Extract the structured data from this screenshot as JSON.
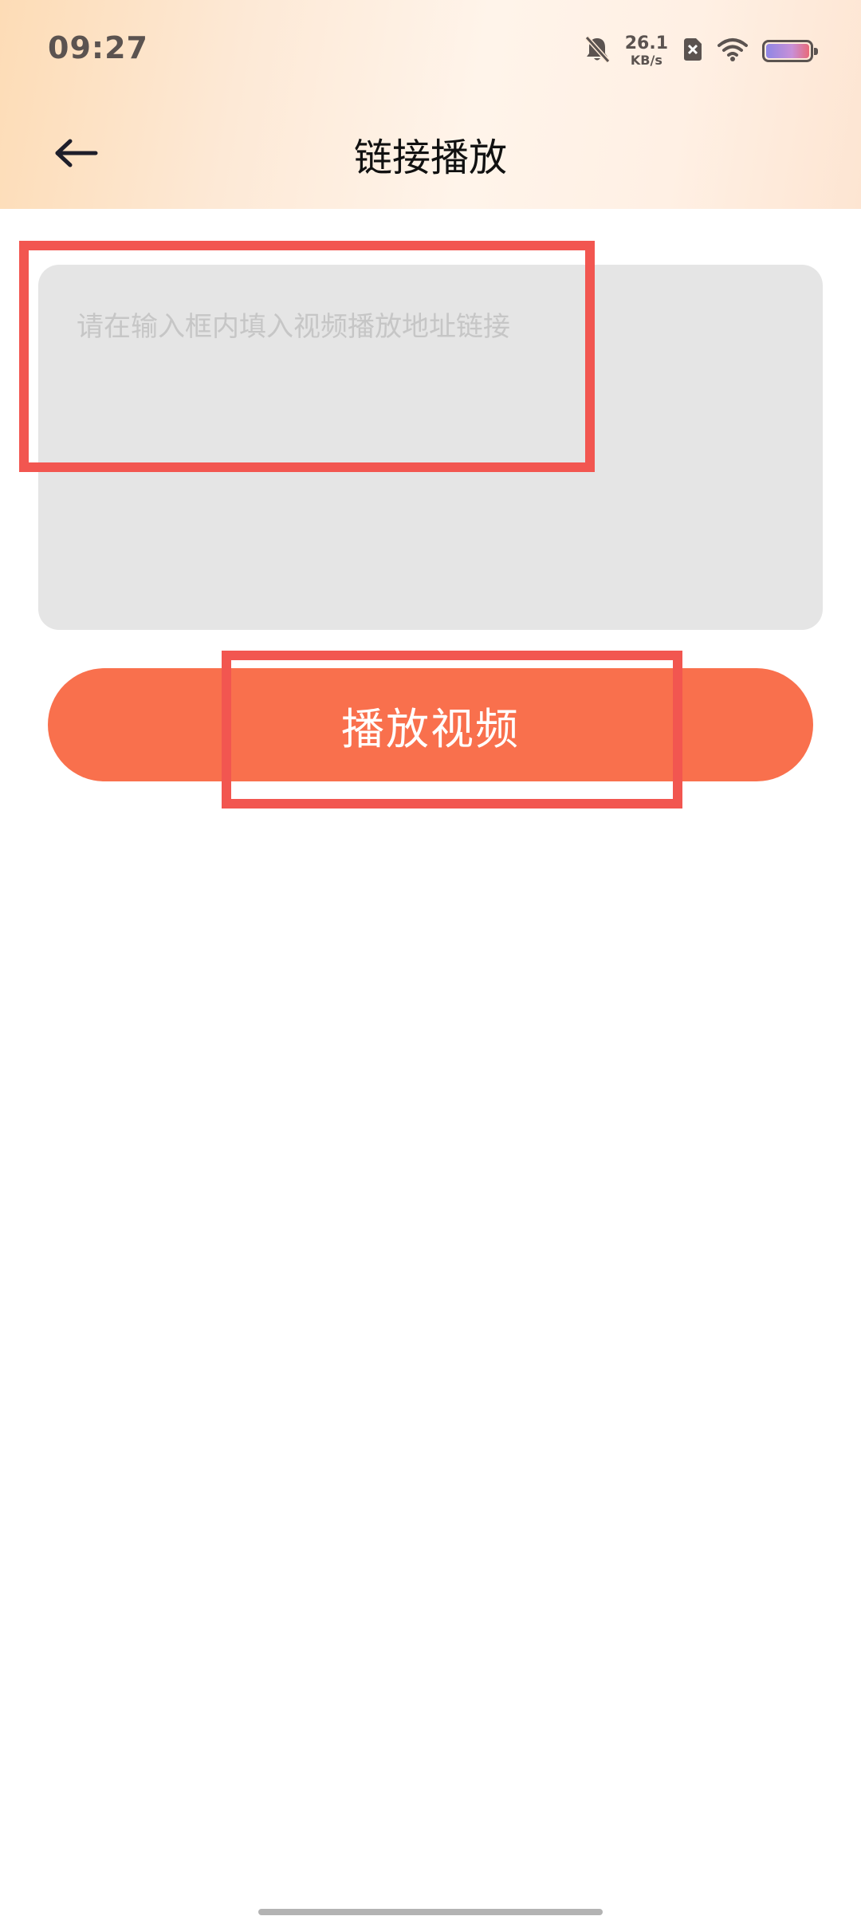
{
  "status_bar": {
    "time": "09:27",
    "net_speed_value": "26.1",
    "net_speed_unit": "KB/s",
    "icons": [
      "bell-muted-icon",
      "sim-x-icon",
      "wifi-icon",
      "battery-icon"
    ]
  },
  "header": {
    "back_icon": "arrow-left-icon",
    "title": "链接播放"
  },
  "input": {
    "placeholder": "请在输入框内填入视频播放地址链接",
    "value": ""
  },
  "play_button": {
    "label": "播放视频"
  },
  "colors": {
    "accent": "#f9704d",
    "input_bg": "#e5e5e5",
    "highlight": "#f25650",
    "title_text": "#111111"
  }
}
